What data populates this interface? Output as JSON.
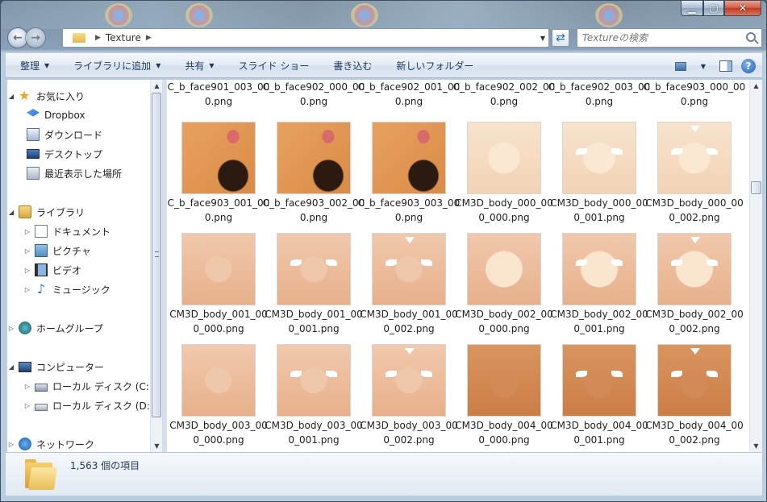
{
  "window": {
    "address": {
      "segments": [
        "Texture"
      ]
    },
    "search": {
      "placeholder": "Textureの検索"
    }
  },
  "toolbar": {
    "items": [
      {
        "label": "整理",
        "dropdown": true
      },
      {
        "label": "ライブラリに追加",
        "dropdown": true
      },
      {
        "label": "共有",
        "dropdown": true
      },
      {
        "label": "スライド ショー",
        "dropdown": false
      },
      {
        "label": "書き込む",
        "dropdown": false
      },
      {
        "label": "新しいフォルダー",
        "dropdown": false
      }
    ]
  },
  "nav": {
    "favorites": "お気に入り",
    "dropbox": "Dropbox",
    "downloads": "ダウンロード",
    "desktop": "デスクトップ",
    "recent": "最近表示した場所",
    "libraries": "ライブラリ",
    "documents": "ドキュメント",
    "pictures": "ピクチャ",
    "videos": "ビデオ",
    "music": "ミュージック",
    "homegroup": "ホームグループ",
    "computer": "コンピューター",
    "disk_c": "ローカル ディスク (C:)",
    "disk_d": "ローカル ディスク (D:)",
    "network": "ネットワーク"
  },
  "files": {
    "row0": [
      "C_b_face901_003_000.png",
      "C_b_face902_000_000.png",
      "C_b_face902_001_000.png",
      "C_b_face902_002_000.png",
      "C_b_face902_003_000.png",
      "C_b_face903_000_000.png"
    ],
    "row1": [
      "C_b_face903_001_000.png",
      "C_b_face903_002_000.png",
      "C_b_face903_003_000.png",
      "CM3D_body_000_000_000.png",
      "CM3D_body_000_000_001.png",
      "CM3D_body_000_000_002.png"
    ],
    "row2": [
      "CM3D_body_001_000_000.png",
      "CM3D_body_001_000_001.png",
      "CM3D_body_001_000_002.png",
      "CM3D_body_002_000_000.png",
      "CM3D_body_002_000_001.png",
      "CM3D_body_002_000_002.png"
    ],
    "row3": [
      "CM3D_body_003_000_000.png",
      "CM3D_body_003_000_001.png",
      "CM3D_body_003_000_002.png",
      "CM3D_body_004_000_000.png",
      "CM3D_body_004_000_001.png",
      "CM3D_body_004_000_002.png"
    ]
  },
  "status": {
    "item_count": "1,563 個の項目"
  }
}
